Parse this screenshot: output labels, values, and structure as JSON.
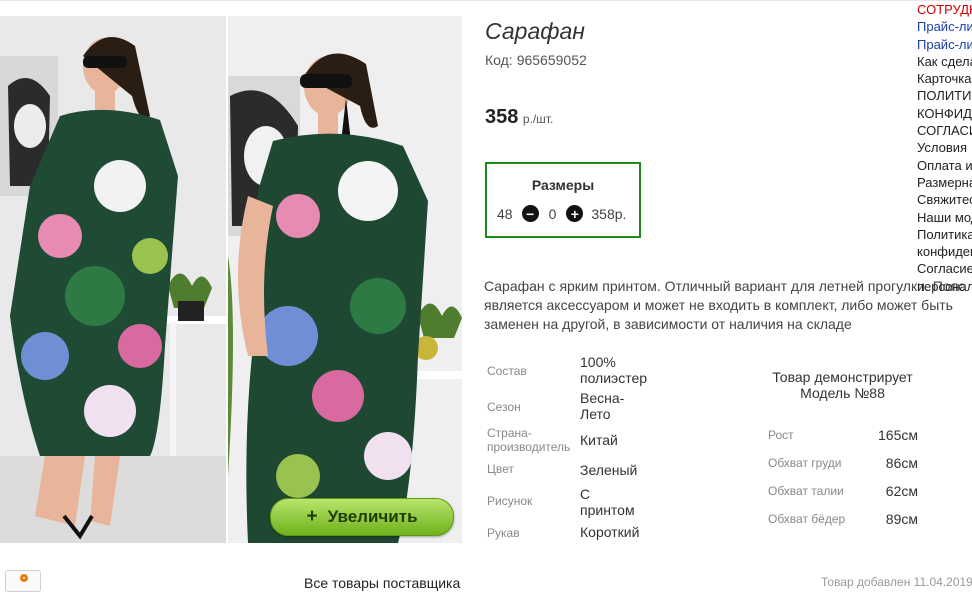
{
  "product": {
    "title": "Сарафан",
    "code_label": "Код:",
    "code": "965659052",
    "price": "358",
    "price_unit": "р./шт."
  },
  "sizes": {
    "heading": "Размеры",
    "size": "48",
    "minus_icon": "minus-circle-icon",
    "quantity": "0",
    "plus_icon": "plus-circle-icon",
    "price": "358р."
  },
  "description": [
    "Сарафан с ярким принтом. Отличный вариант для летней прогулки. Пояс",
    "является аксессуаром и может не входить в комплект, либо может быть",
    "заменен на другой, в зависимости от наличия на складе"
  ],
  "properties": [
    {
      "label": "Состав",
      "value": "100% полиэстер"
    },
    {
      "label": "Сезон",
      "value": "Весна-Лето"
    },
    {
      "label": "Страна-производитель",
      "value": "Китай"
    },
    {
      "label": "Цвет",
      "value": "Зеленый"
    },
    {
      "label": "Рисунок",
      "value": "С принтом"
    },
    {
      "label": "Рукав",
      "value": "Короткий"
    }
  ],
  "model": {
    "heading": "Товар демонстрирует Модель №88",
    "heading_line1": "Товар демонстрирует",
    "heading_line2": "Модель №88",
    "params": [
      {
        "label": "Рост",
        "value": "165см"
      },
      {
        "label": "Обхват груди",
        "value": "86см"
      },
      {
        "label": "Обхват талии",
        "value": "62см"
      },
      {
        "label": "Обхват бёдер",
        "value": "89см"
      }
    ]
  },
  "gallery": {
    "zoom_label": "Увеличить",
    "zoom_icon": "+"
  },
  "sidebar": {
    "links": [
      {
        "label": "СОТРУДНИЧЕСТВО",
        "style": "red"
      },
      {
        "label": "Прайс-лист",
        "style": "blue"
      },
      {
        "label": "Прайс-лист",
        "style": "blue"
      },
      {
        "label": "Как сделать заказ",
        "style": "normal"
      },
      {
        "label": "Карточка",
        "style": "normal"
      },
      {
        "label": "ПОЛИТИКА",
        "style": "normal"
      },
      {
        "label": "КОНФИДЕНЦИАЛЬНОСТИ",
        "style": "normal"
      },
      {
        "label": "СОГЛАСИЕ",
        "style": "normal"
      },
      {
        "label": "Условия",
        "style": "normal"
      },
      {
        "label": "Оплата и доставка",
        "style": "normal"
      },
      {
        "label": "Размерная сетка",
        "style": "normal"
      },
      {
        "label": "Свяжитесь с нами",
        "style": "normal"
      },
      {
        "label": "Наши модели",
        "style": "normal"
      },
      {
        "label": "Политика",
        "style": "normal"
      },
      {
        "label": "конфиденциальности",
        "style": "normal"
      },
      {
        "label": "Согласие на обработку",
        "style": "normal"
      },
      {
        "label": "персональных данных",
        "style": "normal"
      }
    ]
  },
  "footer": {
    "all_goods": "Все товары поставщика",
    "added": "Товар добавлен 11.04.2019"
  },
  "colors": {
    "accent_green": "#1e8a1e",
    "zoom_green": "#8cc63f",
    "link_red": "#d00000",
    "link_blue": "#1a3fa6"
  }
}
